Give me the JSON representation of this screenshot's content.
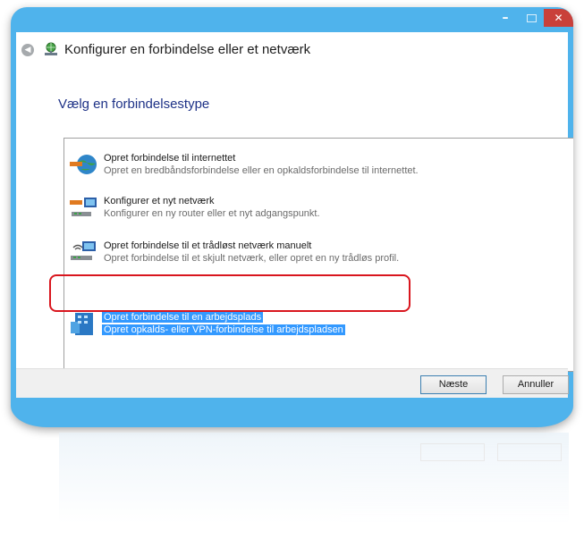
{
  "window": {
    "title": "Konfigurer en forbindelse eller et netværk",
    "accent_color": "#4fb3ec",
    "close_color": "#c9403a"
  },
  "titlebar": {
    "minimize_icon": "minimize-icon",
    "maximize_icon": "maximize-icon",
    "close_icon": "close-icon",
    "minimize_glyph": "–",
    "close_glyph": "✕"
  },
  "nav": {
    "back_glyph": "◀"
  },
  "main": {
    "heading": "Vælg en forbindelsestype",
    "options": [
      {
        "title": "Opret forbindelse til internettet",
        "description": "Opret en bredbåndsforbindelse eller en opkaldsforbindelse til internettet.",
        "icon": "globe-connection-icon",
        "selected": false
      },
      {
        "title": "Konfigurer et nyt netværk",
        "description": "Konfigurer en ny router eller et nyt adgangspunkt.",
        "icon": "network-router-icon",
        "selected": false
      },
      {
        "title": "Opret forbindelse til et trådløst netværk manuelt",
        "description": "Opret forbindelse til et skjult netværk, eller opret en ny trådløs profil.",
        "icon": "wireless-network-icon",
        "selected": false
      },
      {
        "title": "Opret forbindelse til en arbejdsplads",
        "description": "Opret opkalds- eller VPN-forbindelse til arbejdspladsen",
        "icon": "workplace-icon",
        "selected": true
      }
    ],
    "highlight_color": "#d9161e",
    "selection_color": "#3399ff"
  },
  "footer": {
    "next_label": "Næste",
    "cancel_label": "Annuller"
  }
}
